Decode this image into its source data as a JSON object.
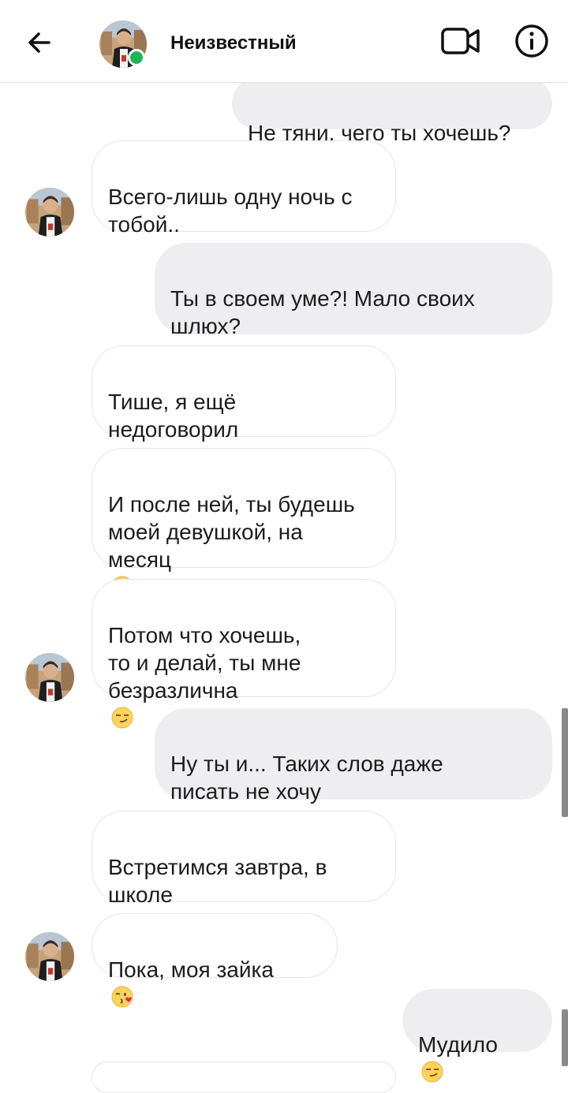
{
  "header": {
    "contact_name": "Неизвестный",
    "back_icon": "arrow-left-icon",
    "video_icon": "video-call-icon",
    "info_icon": "info-icon",
    "online_color": "#1fb45a"
  },
  "messages": [
    {
      "from": "me",
      "text": "Не тяни,  чего ты хочешь?"
    },
    {
      "from": "them",
      "text": "Всего-лишь одну ночь с\nтобой.."
    },
    {
      "from": "me",
      "text": "Ты в своем уме?!  Мало своих\nшлюх?"
    },
    {
      "from": "them",
      "text": "Тише,  я ещё\nнедоговорил"
    },
    {
      "from": "them",
      "text": "И после ней,  ты будешь\nмоей девушкой,  на\nмесяц",
      "emoji": "wink"
    },
    {
      "from": "them",
      "text": "Потом что хочешь,\nто и делай,  ты мне\nбезразлична",
      "emoji": "smirk"
    },
    {
      "from": "me",
      "text": "Ну ты и...  Таких слов даже\nписать не хочу"
    },
    {
      "from": "them",
      "text": "Встретимся завтра,  в\nшколе"
    },
    {
      "from": "them",
      "text": "Пока,  моя зайка",
      "emoji": "kiss"
    },
    {
      "from": "me",
      "text": "Мудило",
      "emoji": "smirk"
    }
  ],
  "colors": {
    "outgoing_bubble": "#eeeef0",
    "incoming_border": "#e4e4e4"
  }
}
